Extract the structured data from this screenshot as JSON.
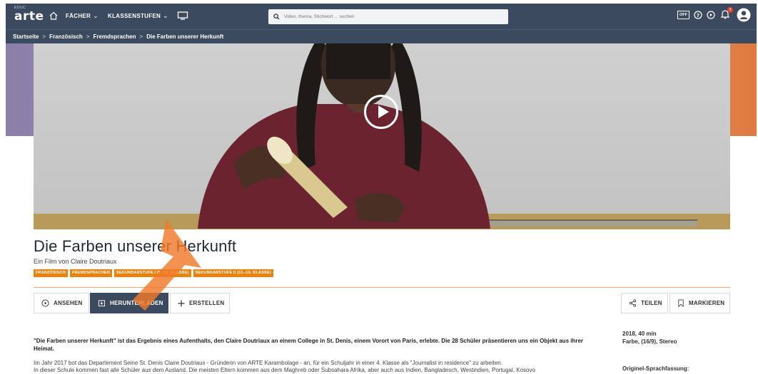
{
  "nav": {
    "logo_small": "EDUC",
    "logo_brand": "arte",
    "subjects": "FÄCHER",
    "grades": "KLASSENSTUFEN",
    "search_placeholder": "Video, thema, Stichwort ... suchen",
    "offline_badge": "OFF",
    "notification_count": "3"
  },
  "breadcrumb": {
    "items": [
      "Startseite",
      "Französisch",
      "Fremdsprachen",
      "Die Farben unserer Herkunft"
    ],
    "separator": ">"
  },
  "video": {
    "title": "Die Farben unserer Herkunft",
    "subtitle": "Ein Film von Claire Doutriaux",
    "tags": [
      "FRANZÖSISCH",
      "FREMDSPRACHEN",
      "SEKUNDARSTUFE I (5.-10. KLASSE)",
      "SEKUNDARSTUFE II (11.-13. KLASSE)"
    ]
  },
  "actions": {
    "watch": "ANSEHEN",
    "download": "HERUNTERLADEN",
    "create": "ERSTELLEN",
    "share": "TEILEN",
    "bookmark": "MARKIEREN"
  },
  "description": {
    "lead": "\"Die Farben unserer Herkunft\" ist das Ergebnis eines Aufenthalts, den Claire Doutriaux an einem College in St. Denis, einem Vorort von Paris, erlebte. Die 28 Schüler präsentieren uns ein Objekt aus ihrer Heimat.",
    "body_line1": "Im Jahr 2017 bot das Departement Seine St. Denis Claire Doutriaux - Gründerin von ARTE Karambolage - an, für ein Schuljahr in einer 4. Klasse als \"Journalist in residence\" zu arbeiten.",
    "body_line2": "In dieser Schule kommen fast alle Schüler aus dem Ausland. Die meisten Eltern kommen aus dem Maghreb oder Subsahara Afrika, aber auch aus Indien, Bangladesch, Westindien, Portugal, Kosovo"
  },
  "meta": {
    "year_duration": "2018, 40 min",
    "format": "Farbe, (16/9), Stereo",
    "original_label": "Originel-Sprachfassung:"
  },
  "colors": {
    "nav_bg": "#3b4a5e",
    "accent_orange": "#e8840e",
    "arrow_orange": "#f07a2a"
  }
}
